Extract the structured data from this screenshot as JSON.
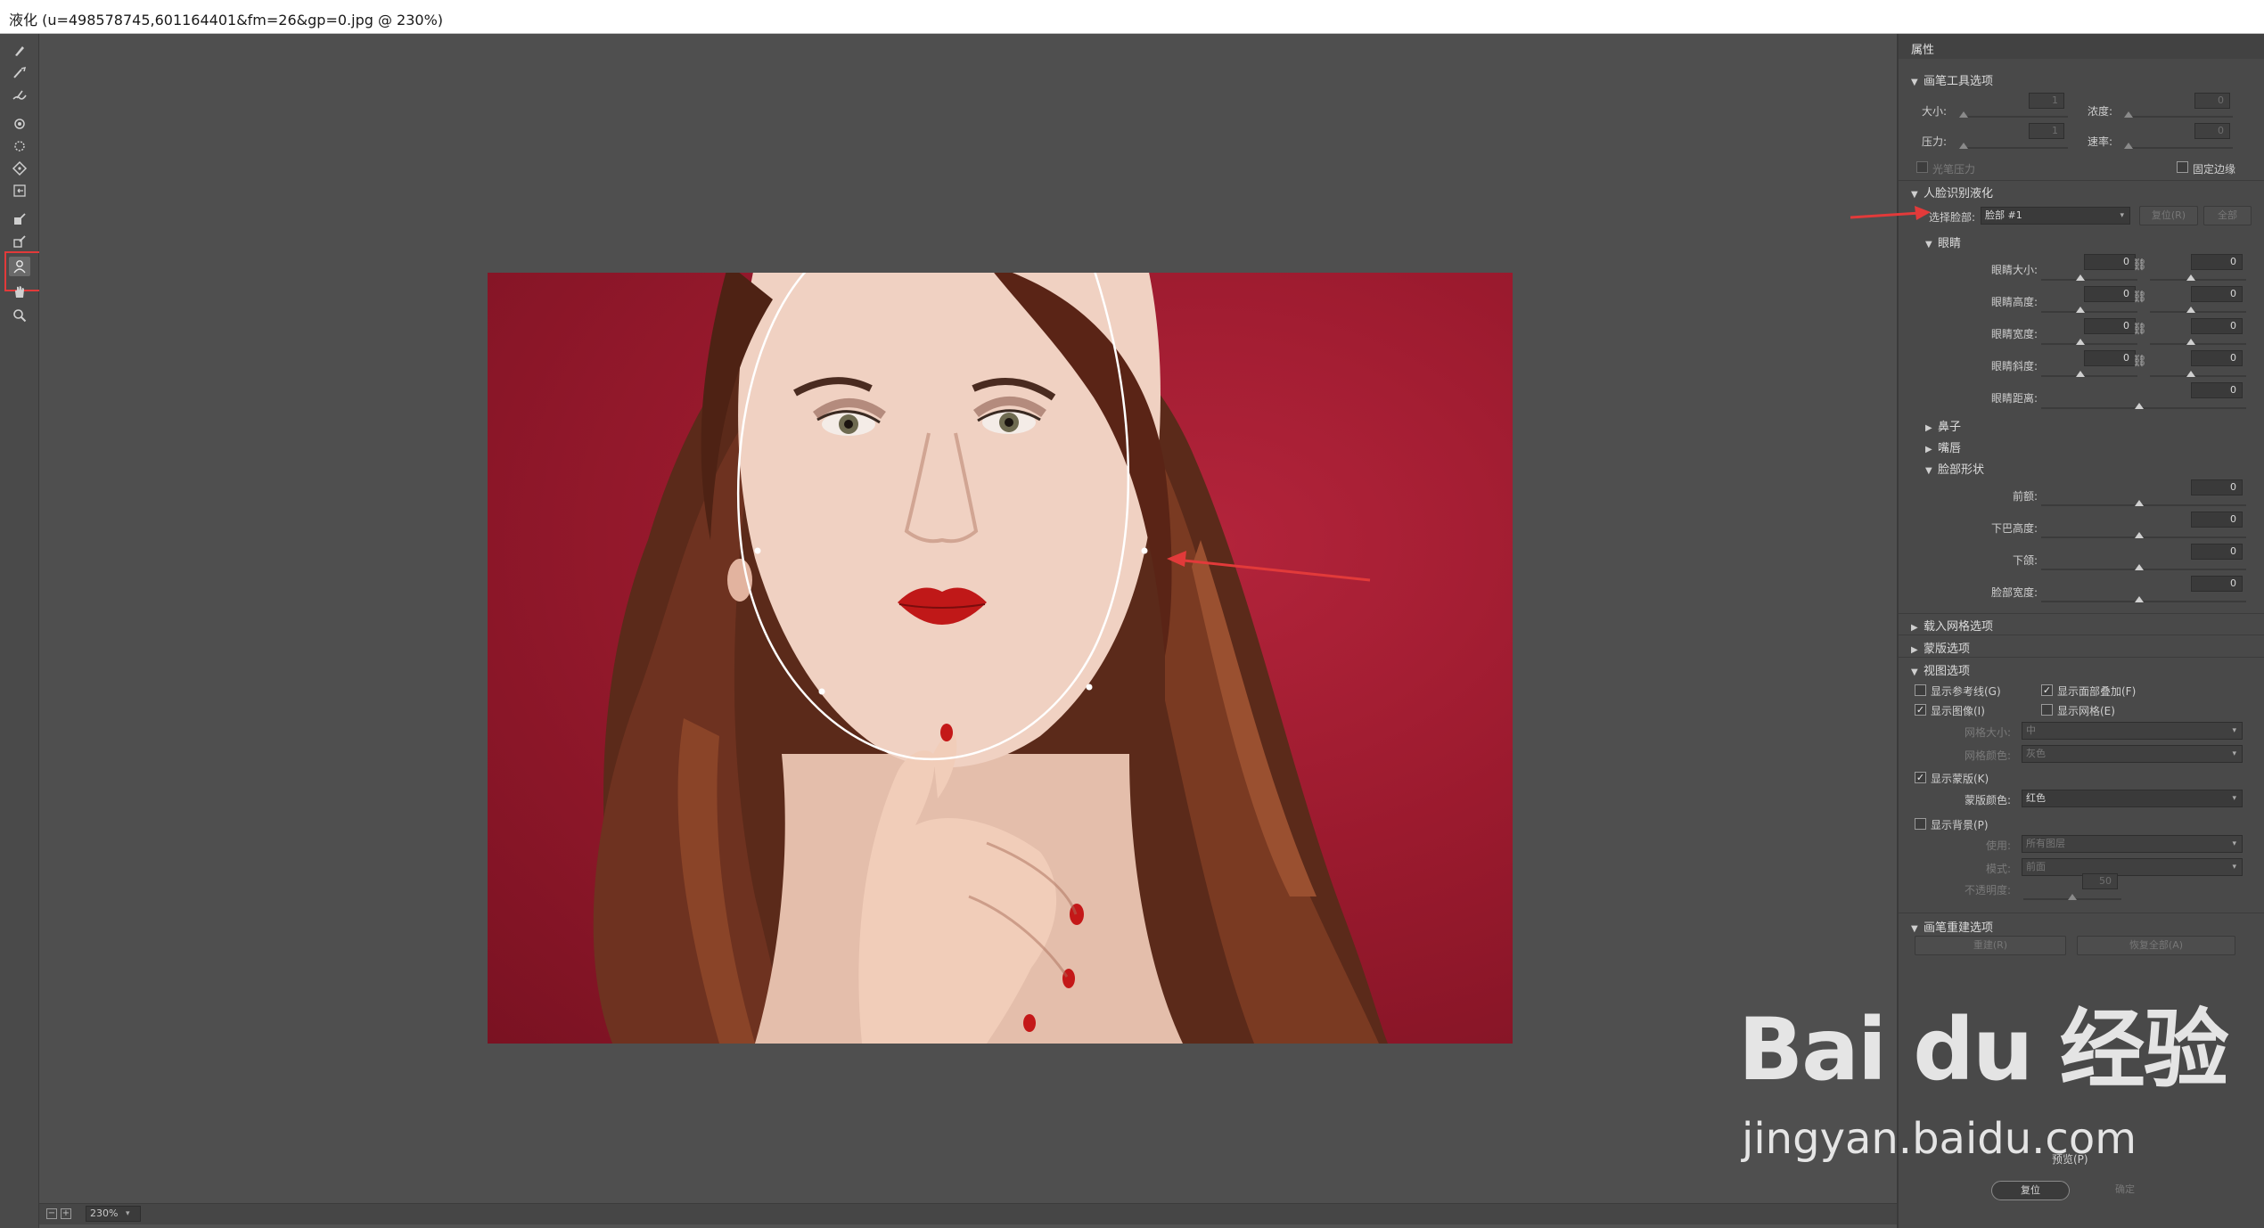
{
  "window": {
    "title": "液化 (u=498578745,601164401&fm=26&gp=0.jpg @ 230%)"
  },
  "tools": [
    {
      "icon": "forward-warp-tool-icon"
    },
    {
      "icon": "reconstruct-tool-icon"
    },
    {
      "icon": "smooth-tool-icon"
    },
    {
      "icon": "twirl-tool-icon"
    },
    {
      "icon": "pucker-tool-icon"
    },
    {
      "icon": "bloat-tool-icon"
    },
    {
      "icon": "push-left-tool-icon"
    },
    {
      "icon": "freeze-mask-tool-icon"
    },
    {
      "icon": "thaw-mask-tool-icon"
    },
    {
      "icon": "face-tool-icon",
      "selected": true
    },
    {
      "icon": "hand-tool-icon"
    },
    {
      "icon": "zoom-tool-icon"
    }
  ],
  "status": {
    "zoom": "230%",
    "zoom_out": "−",
    "zoom_in": "+"
  },
  "panel": {
    "title": "属性",
    "brush_tool_options": {
      "title": "画笔工具选项",
      "size_label": "大小:",
      "size_value": "1",
      "density_label": "浓度:",
      "density_value": "0",
      "pressure_label": "压力:",
      "pressure_value": "1",
      "rate_label": "速率:",
      "rate_value": "0",
      "stylus_label": "光笔压力",
      "pin_edges_label": "固定边缘"
    },
    "face_aware": {
      "title": "人脸识别液化",
      "select_face_label": "选择脸部:",
      "select_face_value": "脸部 #1",
      "reset_button": "复位(R)",
      "all_button": "全部",
      "eyes": {
        "title": "眼睛",
        "rows": [
          {
            "label": "眼睛大小:",
            "left": "0",
            "right": "0"
          },
          {
            "label": "眼睛高度:",
            "left": "0",
            "right": "0"
          },
          {
            "label": "眼睛宽度:",
            "left": "0",
            "right": "0"
          },
          {
            "label": "眼睛斜度:",
            "left": "0",
            "right": "0"
          }
        ],
        "distance_label": "眼睛距离:",
        "distance_value": "0"
      },
      "nose_title": "鼻子",
      "mouth_title": "嘴唇",
      "face_shape": {
        "title": "脸部形状",
        "rows": [
          {
            "label": "前额:",
            "value": "0"
          },
          {
            "label": "下巴高度:",
            "value": "0"
          },
          {
            "label": "下颌:",
            "value": "0"
          },
          {
            "label": "脸部宽度:",
            "value": "0"
          }
        ]
      }
    },
    "load_mesh_title": "载入网格选项",
    "mask_options_title": "蒙版选项",
    "view_options": {
      "title": "视图选项",
      "show_guides": "显示参考线(G)",
      "show_face_overlay": "显示面部叠加(F)",
      "show_image": "显示图像(I)",
      "show_mesh": "显示网格(E)",
      "mesh_size_label": "网格大小:",
      "mesh_size_value": "中",
      "mesh_color_label": "网格颜色:",
      "mesh_color_value": "灰色",
      "show_mask": "显示蒙版(K)",
      "mask_color_label": "蒙版颜色:",
      "mask_color_value": "红色",
      "show_backdrop": "显示背景(P)",
      "use_label": "使用:",
      "use_value": "所有图层",
      "mode_label": "模式:",
      "mode_value": "前面",
      "opacity_label": "不透明度:",
      "opacity_value": "50"
    },
    "brush_reconstruct": {
      "title": "画笔重建选项",
      "reconstruct_button": "重建(R)",
      "restore_all_button": "恢复全部(A)"
    },
    "preview_label": "预览(P)",
    "reset_main_button": "复位",
    "ok_button": "确定"
  },
  "watermark": {
    "brand": "Bai du 经验",
    "url": "jingyan.baidu.com"
  },
  "colors": {
    "annotation": "#e23a3a",
    "panel": "#494949",
    "canvas": "#4f4f4f"
  }
}
